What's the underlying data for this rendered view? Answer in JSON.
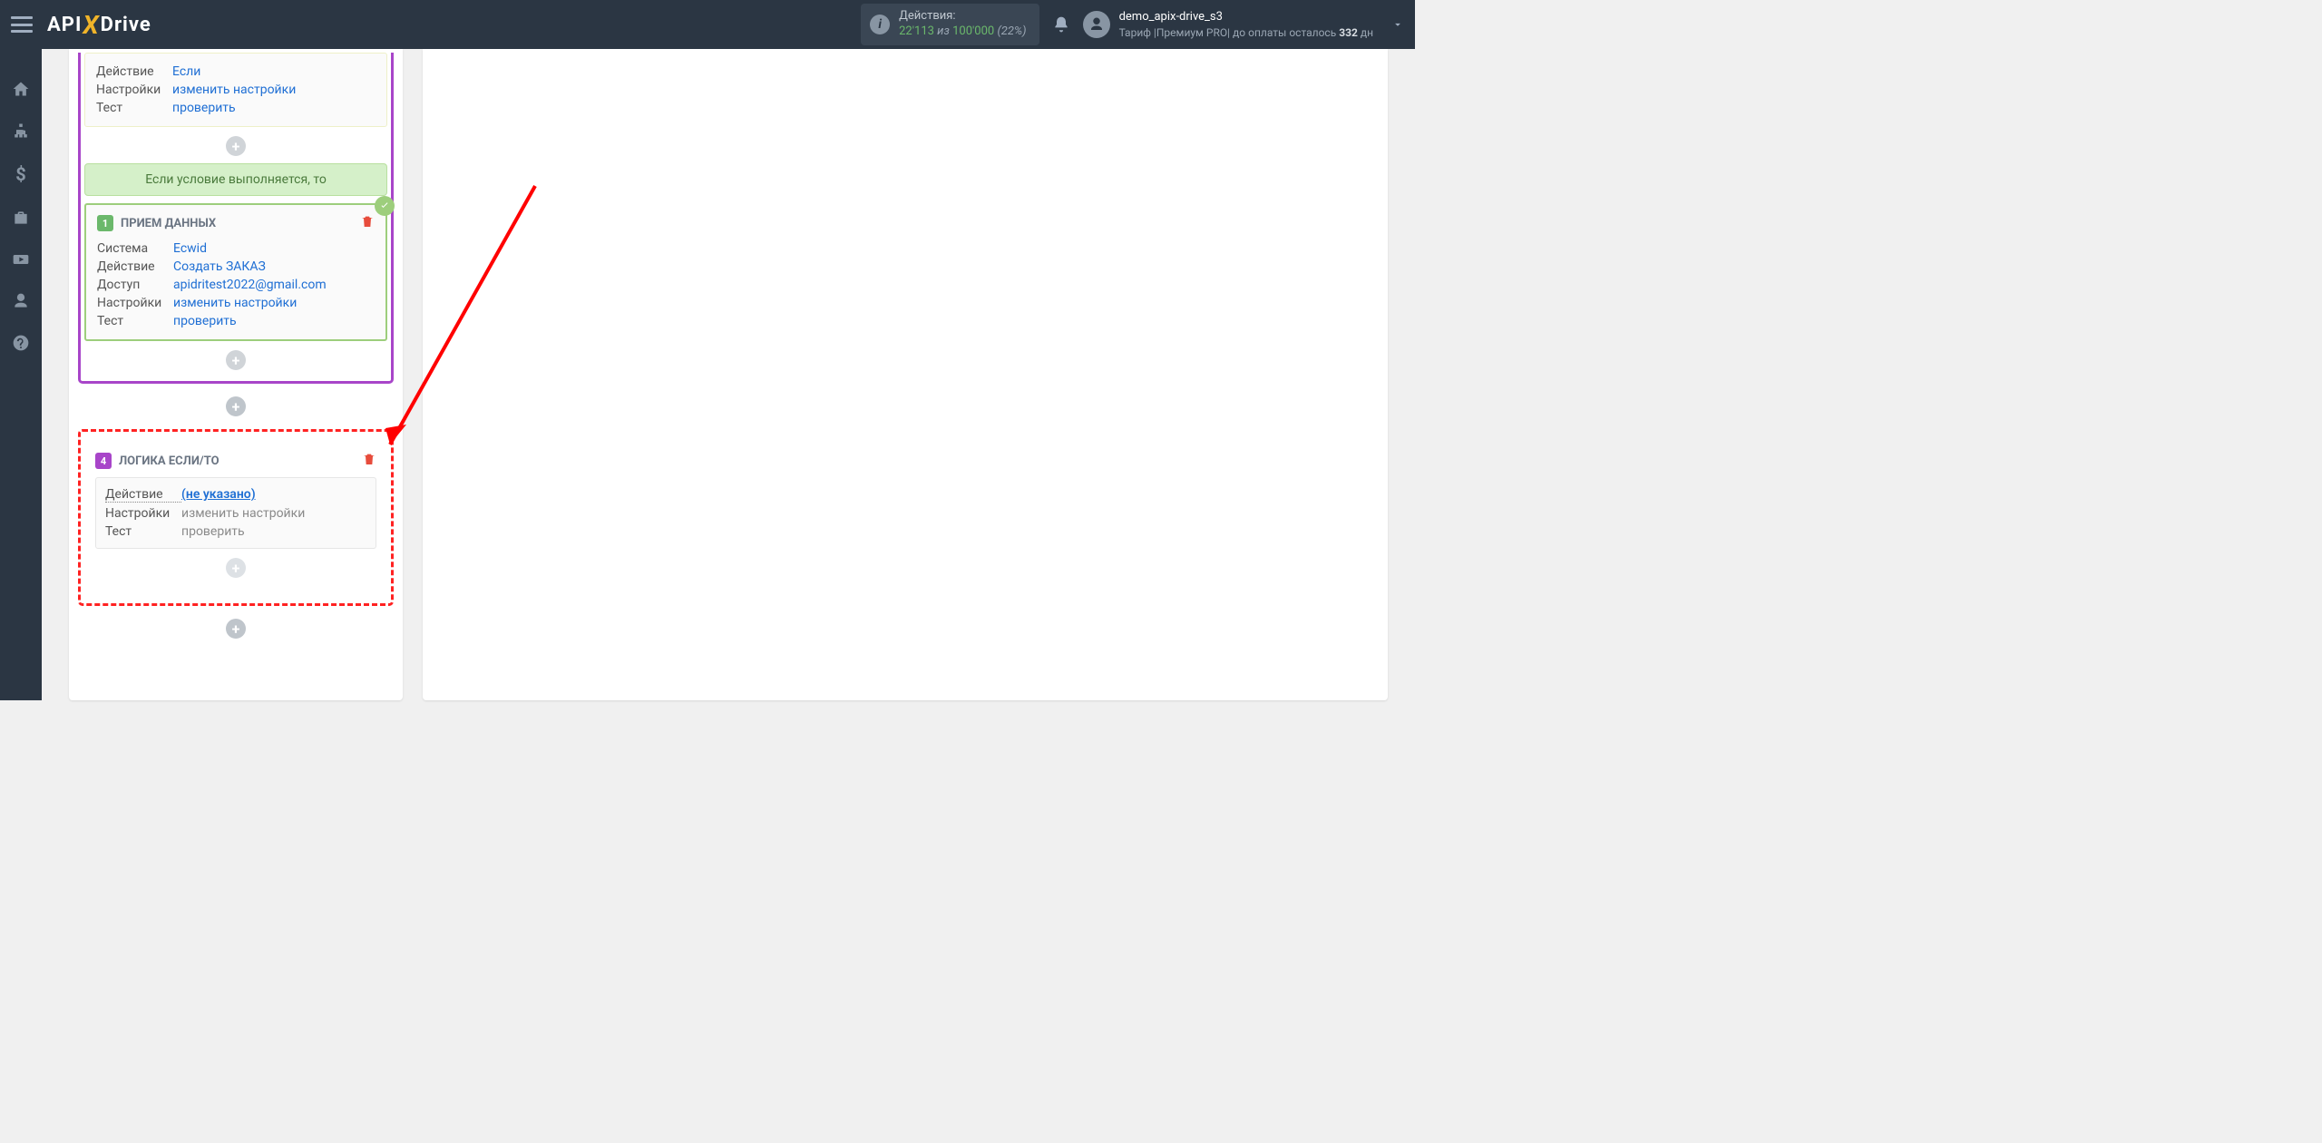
{
  "header": {
    "actions_label": "Действия:",
    "n1": "22'113",
    "iz": "из",
    "n2": "100'000",
    "pct": "(22%)",
    "username": "demo_apix-drive_s3",
    "tariff_prefix": "Тариф |",
    "tariff_plan": "Премиум PRO",
    "tariff_mid": "| до оплаты осталось ",
    "tariff_days": "332",
    "tariff_suffix": " дн"
  },
  "card1": {
    "r1_label": "Действие",
    "r1_value": "Если",
    "r2_label": "Настройки",
    "r2_value": "изменить настройки",
    "r3_label": "Тест",
    "r3_value": "проверить"
  },
  "condition_text": "Если условие выполняется, то",
  "card2": {
    "step": "1",
    "title": "ПРИЕМ ДАННЫХ",
    "r1_label": "Система",
    "r1_value": "Ecwid",
    "r2_label": "Действие",
    "r2_value": "Создать ЗАКАЗ",
    "r3_label": "Доступ",
    "r3_value": "apidritest2022@gmail.com",
    "r4_label": "Настройки",
    "r4_value": "изменить настройки",
    "r5_label": "Тест",
    "r5_value": "проверить"
  },
  "card3": {
    "step": "4",
    "title": "ЛОГИКА ЕСЛИ/ТО",
    "r1_label": "Действие",
    "r1_value": "(не указано)",
    "r2_label": "Настройки",
    "r2_value": "изменить настройки",
    "r3_label": "Тест",
    "r3_value": "проверить"
  }
}
